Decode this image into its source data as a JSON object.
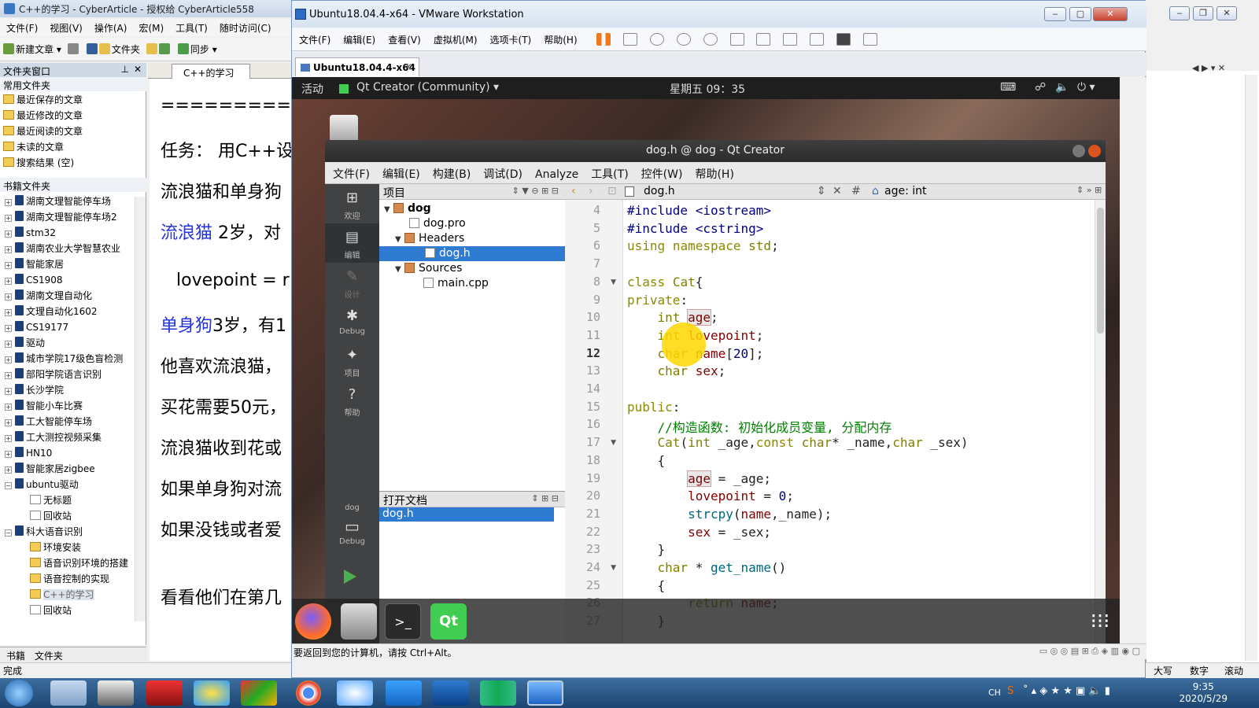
{
  "cyberarticle": {
    "title": "C++的学习 - CyberArticle - 授权给 CyberArticle558",
    "menu": [
      "文件(F)",
      "视图(V)",
      "操作(A)",
      "宏(M)",
      "工具(T)",
      "随时访问(C)"
    ],
    "toolbar": {
      "new_article": "新建文章",
      "folder": "文件夹",
      "sync": "同步"
    },
    "folder_pane_title": "文件夹窗口",
    "common_folders_header": "常用文件夹",
    "common_folders": [
      "最近保存的文章",
      "最近修改的文章",
      "最近阅读的文章",
      "未读的文章",
      "搜索结果 (空)"
    ],
    "bookshelf_header": "书籍文件夹",
    "books": [
      "湖南文理智能停车场",
      "湖南文理智能停车场2",
      "stm32",
      "湖南农业大学智慧农业",
      "智能家居",
      "CS1908",
      "湖南文理自动化",
      "文理自动化1602",
      "CS19177",
      "驱动",
      "城市学院17级色盲检测",
      "部阳学院语言识别",
      "长沙学院",
      "智能小车比赛",
      "工大智能停车场",
      "工大测控视频采集",
      "HN10",
      "智能家居zigbee",
      "ubuntu驱动"
    ],
    "ubuntu_children": [
      "无标题",
      "回收站"
    ],
    "voice_book": "科大语音识别",
    "voice_children": [
      "环境安装",
      "语音识别环境的搭建",
      "语音控制的实现",
      "C++的学习",
      "回收站"
    ],
    "bottom_tabs": [
      "书籍",
      "文件夹"
    ],
    "doc_tab": "C++的学习",
    "doc_lines": [
      "=========",
      "任务： 用C++设",
      "流浪猫和单身狗",
      "流浪猫",
      " 2岁，对",
      "lovepoint = r",
      "单身狗",
      "3岁，有1",
      "他喜欢流浪猫，",
      "买花需要50元，",
      "流浪猫收到花或",
      "如果单身狗对流",
      "如果没钱或者爱",
      "看看他们在第几"
    ],
    "status": "完成",
    "right_status": [
      "大写",
      "数字",
      "滚动"
    ]
  },
  "vmware": {
    "title": "Ubuntu18.04.4-x64 - VMware Workstation",
    "menu": [
      "文件(F)",
      "编辑(E)",
      "查看(V)",
      "虚拟机(M)",
      "选项卡(T)",
      "帮助(H)"
    ],
    "tab": "Ubuntu18.04.4-x64",
    "status": "要返回到您的计算机，请按 Ctrl+Alt。"
  },
  "gnome": {
    "activities": "活动",
    "app_menu": "Qt Creator (Community) ▾",
    "clock": "星期五 09：35"
  },
  "qt": {
    "title": "dog.h @ dog - Qt Creator",
    "menu": [
      "文件(F)",
      "编辑(E)",
      "构建(B)",
      "调试(D)",
      "Analyze",
      "工具(T)",
      "控件(W)",
      "帮助(H)"
    ],
    "modes": [
      {
        "label": "欢迎",
        "icon": "⊞"
      },
      {
        "label": "编辑",
        "icon": "▤"
      },
      {
        "label": "设计",
        "icon": "✎"
      },
      {
        "label": "Debug",
        "icon": "✱"
      },
      {
        "label": "项目",
        "icon": "✦"
      },
      {
        "label": "帮助",
        "icon": "?"
      }
    ],
    "kit_project": "dog",
    "kit_mode": "Debug",
    "project_pane_title": "项目",
    "tree": {
      "root": "dog",
      "pro": "dog.pro",
      "headers": "Headers",
      "header_file": "dog.h",
      "sources": "Sources",
      "source_file": "main.cpp"
    },
    "open_docs_title": "打开文档",
    "open_doc": "dog.h",
    "editor_file": "dog.h",
    "editor_symbol": "age: int",
    "current_line": 12,
    "line_numbers": [
      4,
      5,
      6,
      7,
      8,
      9,
      10,
      11,
      12,
      13,
      14,
      15,
      16,
      17,
      18,
      19,
      20,
      21,
      22,
      23,
      24,
      25,
      26,
      27
    ],
    "fold_lines": [
      8,
      17,
      24
    ],
    "code": [
      "#include <iostream>",
      "#include <cstring>",
      "using namespace std;",
      "",
      "class Cat{",
      "private:",
      "    int age;",
      "    int lovepoint;",
      "    char name[20];",
      "    char sex;",
      "",
      "public:",
      "    //构造函数: 初始化成员变量, 分配内存",
      "    Cat(int _age,const char* _name,char _sex)",
      "    {",
      "        age = _age;",
      "        lovepoint = 0;",
      "        strcpy(name,_name);",
      "        sex = _sex;",
      "    }",
      "    char * get_name()",
      "    {",
      "        return name;",
      "    }"
    ]
  },
  "taskbar": {
    "time": "9:35",
    "date": "2020/5/29",
    "lang": "CH"
  }
}
